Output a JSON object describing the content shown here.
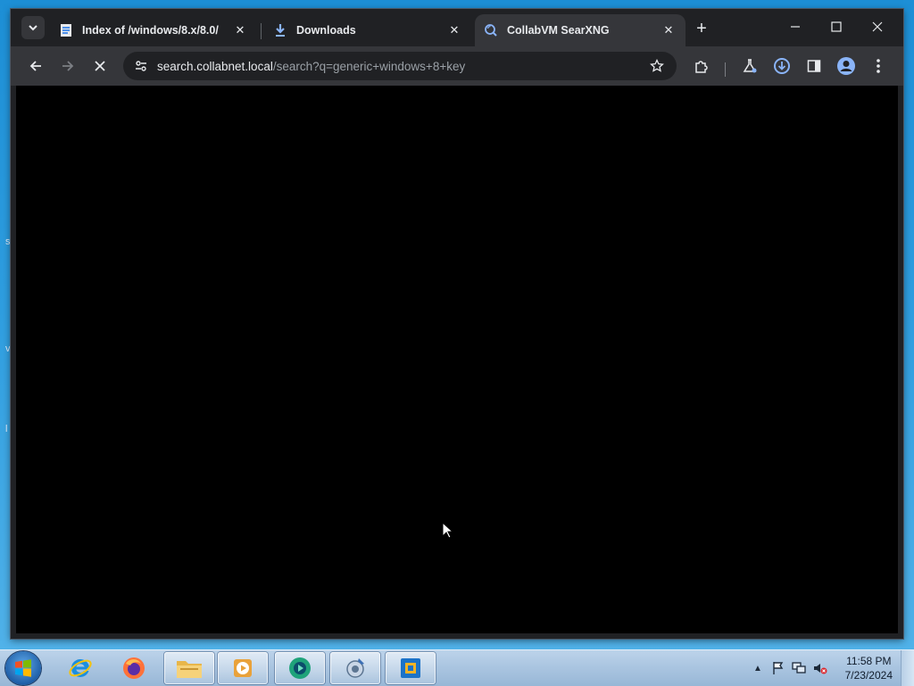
{
  "browser": {
    "tabs": [
      {
        "title": "Index of /windows/8.x/8.0/",
        "favicon": "document-icon",
        "active": false
      },
      {
        "title": "Downloads",
        "favicon": "download-icon",
        "active": false
      },
      {
        "title": "CollabVM SearXNG",
        "favicon": "searxng-icon",
        "active": true
      }
    ],
    "address": {
      "host": "search.collabnet.local",
      "path": "/search?q=generic+windows+8+key"
    },
    "loading": true
  },
  "taskbar": {
    "apps": [
      {
        "name": "internet-explorer-icon",
        "running": false
      },
      {
        "name": "firefox-icon",
        "running": false
      },
      {
        "name": "file-explorer-icon",
        "running": true
      },
      {
        "name": "media-player-icon",
        "running": true
      },
      {
        "name": "browser-icon",
        "running": true
      },
      {
        "name": "tool-icon",
        "running": true
      },
      {
        "name": "vm-icon",
        "running": true
      }
    ],
    "clock": {
      "time": "11:58 PM",
      "date": "7/23/2024"
    }
  },
  "colors": {
    "accent": "#8ab4f8",
    "tab_bg": "#202124",
    "toolbar_bg": "#35363a"
  }
}
